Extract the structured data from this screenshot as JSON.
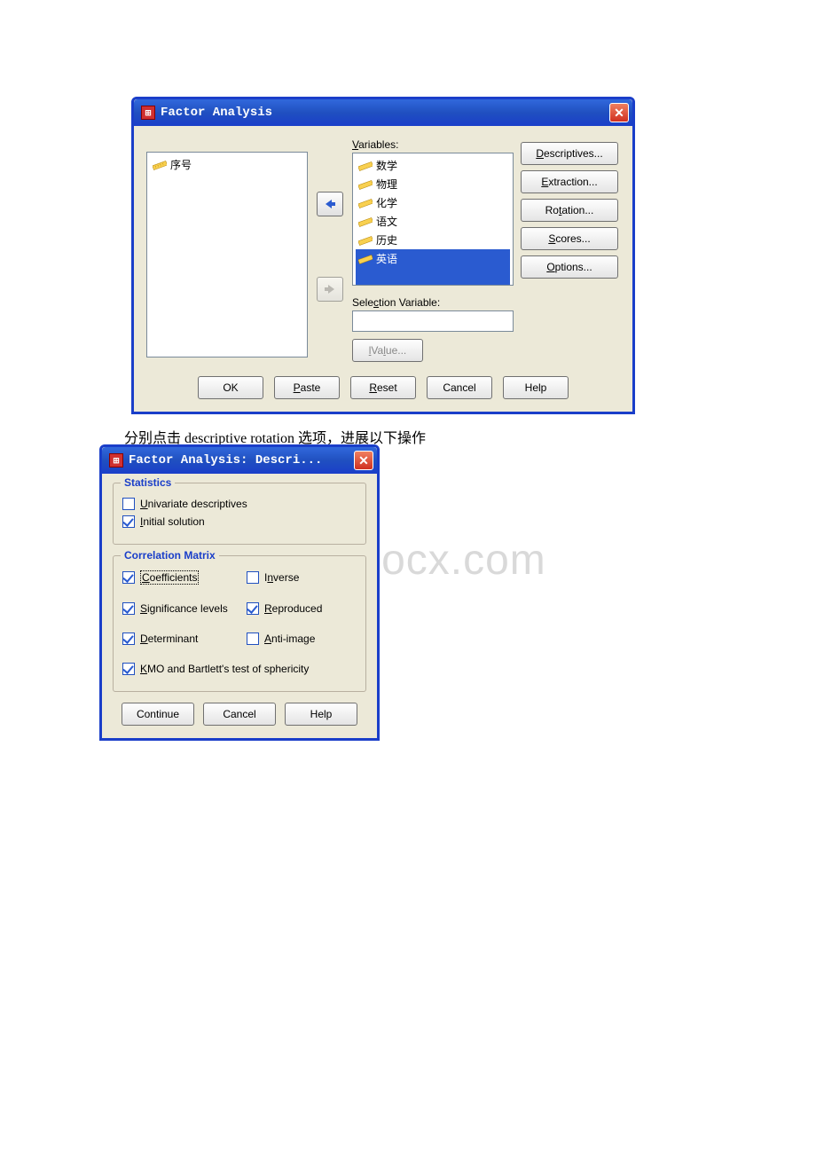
{
  "dialog1": {
    "title": "Factor Analysis",
    "leftList": {
      "items": [
        "序号"
      ]
    },
    "varsLabel_pre": "V",
    "varsLabel_post": "ariables:",
    "variables": [
      "数学",
      "物理",
      "化学",
      "语文",
      "历史",
      "英语"
    ],
    "selectionLabel_pre": "Sele",
    "selectionLabel_u": "c",
    "selectionLabel_post": "tion Variable:",
    "valueBtn": "Value...",
    "sideButtons": {
      "descriptives_u": "D",
      "descriptives": "escriptives...",
      "extraction_u": "E",
      "extraction": "xtraction...",
      "rotation_pre": "Ro",
      "rotation_u": "t",
      "rotation_post": "ation...",
      "scores_u": "S",
      "scores": "cores...",
      "options_u": "O",
      "options": "ptions..."
    },
    "bottom": {
      "ok": "OK",
      "paste_u": "P",
      "paste": "aste",
      "reset_u": "R",
      "reset": "eset",
      "cancel": "Cancel",
      "help": "Help"
    }
  },
  "caption": "分别点击 descriptive rotation 选项，进展以下操作",
  "dialog2": {
    "title": "Factor Analysis: Descri...",
    "statistics": {
      "title": "Statistics",
      "univariate_u": "U",
      "univariate": "nivariate descriptives",
      "initial_u": "I",
      "initial": "nitial solution"
    },
    "corrMatrix": {
      "title": "Correlation Matrix",
      "coefficients_u": "C",
      "coefficients": "oefficients",
      "inverse_pre": "I",
      "inverse_u": "n",
      "inverse_post": "verse",
      "sig_u": "S",
      "sig": "ignificance levels",
      "reproduced_u": "R",
      "reproduced": "eproduced",
      "determinant_u": "D",
      "determinant": "eterminant",
      "anti_u": "A",
      "anti": "nti-image",
      "kmo_u": "K",
      "kmo": "MO and Bartlett's test of sphericity"
    },
    "bottom": {
      "continue": "Continue",
      "cancel": "Cancel",
      "help": "Help"
    }
  },
  "watermark": "www.bdocx.com"
}
